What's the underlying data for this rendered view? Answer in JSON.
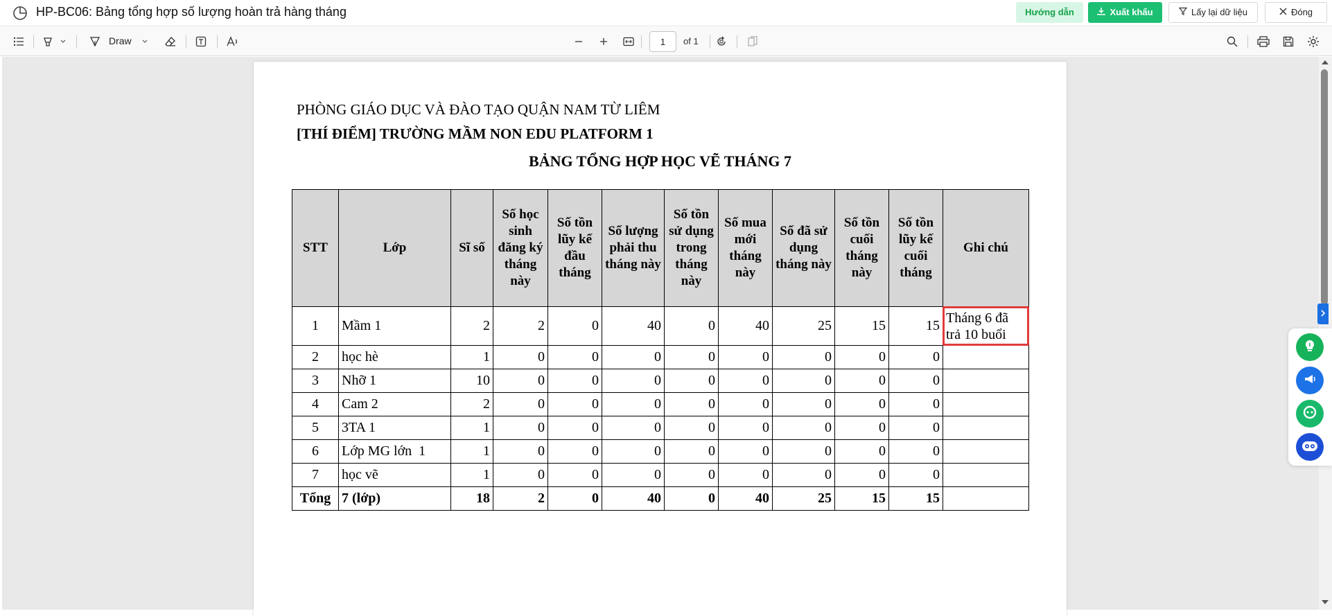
{
  "window": {
    "title": "HP-BC06: Bảng tổng hợp số lượng hoàn trả hàng tháng",
    "buttons": {
      "guide": "Hướng dẫn",
      "export": "Xuất khẩu",
      "fetch": "Lấy lại dữ liệu",
      "close": "Đóng"
    }
  },
  "toolbar": {
    "draw_label": "Draw",
    "page_current": "1",
    "page_total": "of 1"
  },
  "document": {
    "org_line": "PHÒNG GIÁO DỤC VÀ ĐÀO TẠO QUẬN NAM TỪ LIÊM",
    "school_line": "[THÍ ĐIỂM] TRƯỜNG MẦM NON EDU PLATFORM 1",
    "report_title": "BẢNG TỔNG HỢP HỌC VẼ THÁNG 7",
    "table": {
      "headers": {
        "stt": "STT",
        "lop": "Lớp",
        "si_so": "Sĩ số",
        "dang_ky": "Số học sinh đăng ký tháng này",
        "ton_dau": "Số tồn lũy kế đầu tháng",
        "phai_thu": "Số lượng phải thu tháng này",
        "ton_su_dung": "Số tồn sử dụng trong tháng này",
        "mua_moi": "Số mua mới tháng này",
        "da_su_dung": "Số đã sử dụng tháng này",
        "ton_cuoi": "Số tồn cuối tháng này",
        "ton_luy_ke_cuoi": "Số tồn lũy kế cuối tháng",
        "ghi_chu": "Ghi chú"
      },
      "rows": [
        {
          "stt": "1",
          "lop": "Mầm 1",
          "si_so": "2",
          "dang_ky": "2",
          "ton_dau": "0",
          "phai_thu": "40",
          "ton_su_dung": "0",
          "mua_moi": "40",
          "da_su_dung": "25",
          "ton_cuoi": "15",
          "ton_luy_ke_cuoi": "15",
          "ghi_chu": "Tháng 6 đã trả 10 buổi"
        },
        {
          "stt": "2",
          "lop": "học hè",
          "si_so": "1",
          "dang_ky": "0",
          "ton_dau": "0",
          "phai_thu": "0",
          "ton_su_dung": "0",
          "mua_moi": "0",
          "da_su_dung": "0",
          "ton_cuoi": "0",
          "ton_luy_ke_cuoi": "0",
          "ghi_chu": ""
        },
        {
          "stt": "3",
          "lop": "Nhỡ 1",
          "si_so": "10",
          "dang_ky": "0",
          "ton_dau": "0",
          "phai_thu": "0",
          "ton_su_dung": "0",
          "mua_moi": "0",
          "da_su_dung": "0",
          "ton_cuoi": "0",
          "ton_luy_ke_cuoi": "0",
          "ghi_chu": ""
        },
        {
          "stt": "4",
          "lop": "Cam 2",
          "si_so": "2",
          "dang_ky": "0",
          "ton_dau": "0",
          "phai_thu": "0",
          "ton_su_dung": "0",
          "mua_moi": "0",
          "da_su_dung": "0",
          "ton_cuoi": "0",
          "ton_luy_ke_cuoi": "0",
          "ghi_chu": ""
        },
        {
          "stt": "5",
          "lop": "3TA 1",
          "si_so": "1",
          "dang_ky": "0",
          "ton_dau": "0",
          "phai_thu": "0",
          "ton_su_dung": "0",
          "mua_moi": "0",
          "da_su_dung": "0",
          "ton_cuoi": "0",
          "ton_luy_ke_cuoi": "0",
          "ghi_chu": ""
        },
        {
          "stt": "6",
          "lop": "Lớp MG lớn  1",
          "si_so": "1",
          "dang_ky": "0",
          "ton_dau": "0",
          "phai_thu": "0",
          "ton_su_dung": "0",
          "mua_moi": "0",
          "da_su_dung": "0",
          "ton_cuoi": "0",
          "ton_luy_ke_cuoi": "0",
          "ghi_chu": ""
        },
        {
          "stt": "7",
          "lop": "học vẽ",
          "si_so": "1",
          "dang_ky": "0",
          "ton_dau": "0",
          "phai_thu": "0",
          "ton_su_dung": "0",
          "mua_moi": "0",
          "da_su_dung": "0",
          "ton_cuoi": "0",
          "ton_luy_ke_cuoi": "0",
          "ghi_chu": ""
        }
      ],
      "total": {
        "stt": "Tổng",
        "lop": "7 (lớp)",
        "si_so": "18",
        "dang_ky": "2",
        "ton_dau": "0",
        "phai_thu": "40",
        "ton_su_dung": "0",
        "mua_moi": "40",
        "da_su_dung": "25",
        "ton_cuoi": "15",
        "ton_luy_ke_cuoi": "15",
        "ghi_chu": ""
      }
    }
  },
  "icons": {
    "app": "report-chart-icon",
    "toolbar_left": [
      "outline-list-icon",
      "highlight-icon",
      "draw-pen-icon",
      "eraser-icon",
      "text-box-icon",
      "read-aloud-icon"
    ],
    "toolbar_center": [
      "zoom-out-icon",
      "zoom-in-icon",
      "fit-width-icon",
      "rotate-icon",
      "page-view-icon"
    ],
    "toolbar_right": [
      "search-icon",
      "print-icon",
      "save-icon",
      "settings-icon"
    ],
    "widgets": [
      "lightbulb-icon",
      "announcement-icon",
      "chat-support-icon",
      "robot-assistant-icon"
    ]
  },
  "colors": {
    "accent_green": "#1dbf73",
    "guide_bg": "#d8f6e6",
    "header_gray": "#d6d6d6",
    "highlight_red": "#e03b3b",
    "side_tab_blue": "#1b6fe0"
  }
}
